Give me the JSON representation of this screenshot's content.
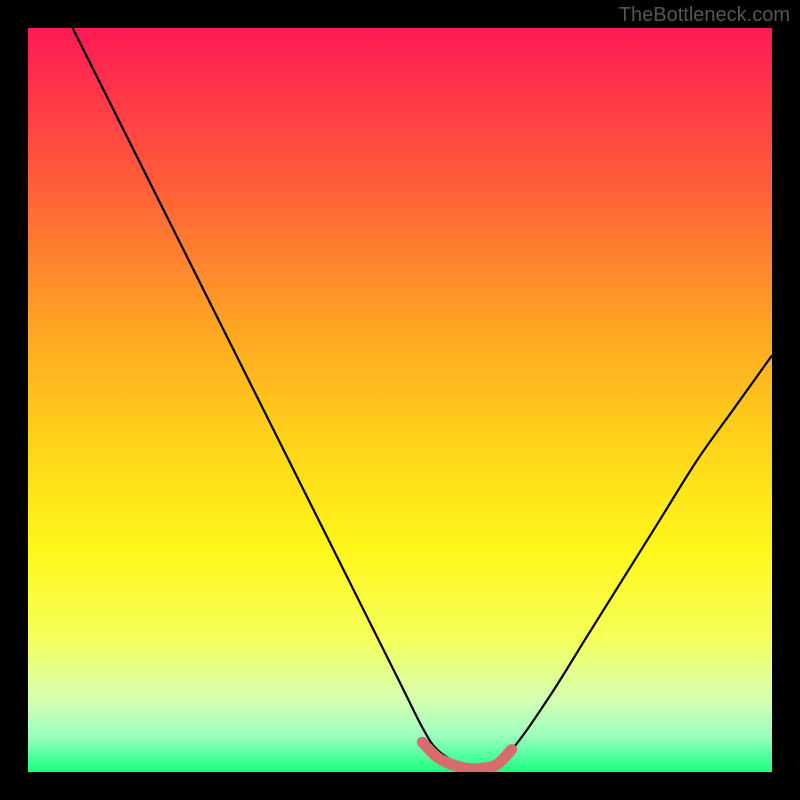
{
  "watermark": "TheBottleneck.com",
  "chart_data": {
    "type": "line",
    "title": "",
    "xlabel": "",
    "ylabel": "",
    "xlim": [
      0,
      100
    ],
    "ylim": [
      0,
      100
    ],
    "series": [
      {
        "name": "curve",
        "x": [
          6,
          10,
          15,
          20,
          25,
          30,
          35,
          40,
          45,
          50,
          53,
          55,
          58,
          60,
          62,
          65,
          70,
          75,
          80,
          85,
          90,
          95,
          100
        ],
        "y": [
          100,
          92,
          82,
          72,
          62,
          52,
          42,
          32,
          22,
          12,
          6,
          3,
          1,
          0.5,
          1,
          3,
          10,
          18,
          26,
          34,
          42,
          49,
          56
        ]
      }
    ],
    "highlight": {
      "name": "bottom-marker",
      "x": [
        53,
        55,
        57,
        59,
        61,
        63,
        65
      ],
      "y": [
        4,
        2,
        1,
        0.5,
        0.5,
        1,
        3
      ]
    },
    "background_gradient": {
      "stops": [
        {
          "offset": 0.0,
          "color": "#ff1a55"
        },
        {
          "offset": 0.2,
          "color": "#ff5a3a"
        },
        {
          "offset": 0.4,
          "color": "#ffa423"
        },
        {
          "offset": 0.55,
          "color": "#ffd21a"
        },
        {
          "offset": 0.7,
          "color": "#fff71a"
        },
        {
          "offset": 0.82,
          "color": "#f5ff5a"
        },
        {
          "offset": 0.9,
          "color": "#d8ffb0"
        },
        {
          "offset": 0.95,
          "color": "#9effc0"
        },
        {
          "offset": 0.98,
          "color": "#4eff9e"
        },
        {
          "offset": 1.0,
          "color": "#1aff7a"
        }
      ]
    }
  }
}
